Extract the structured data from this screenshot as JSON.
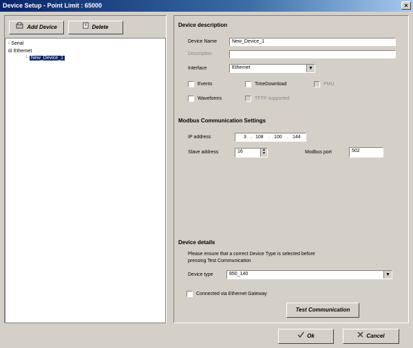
{
  "window": {
    "title": "Device Setup - Point Limit : 65000",
    "close_glyph": "×"
  },
  "left": {
    "add_device_label": "Add Device",
    "delete_label": "Delete",
    "tree": {
      "serial": "Serial",
      "ethernet": "Ethernet",
      "selected_device": "New_Device_1"
    }
  },
  "device_description": {
    "heading": "Device description",
    "name_label": "Device Name",
    "name_value": "New_Device_1",
    "description_label": "Description",
    "description_value": "",
    "interface_label": "Interface",
    "interface_value": "Ethernet",
    "events_label": "Events",
    "timedownload_label": "TimeDownload",
    "pmu_label": "PMU",
    "waveforms_label": "Waveforms",
    "tftp_label": "TFTP supported"
  },
  "modbus": {
    "heading": "Modbus Communication Settings",
    "ip_label": "IP address",
    "ip": [
      "3",
      "108",
      "100",
      "144"
    ],
    "slave_label": "Slave address",
    "slave_value": "16",
    "port_label": "Modbus port",
    "port_value": "502"
  },
  "device_details": {
    "heading": "Device details",
    "note_line1": "Please ensure that a correct Device Type is selected before",
    "note_line2": "pressing Test Communication",
    "type_label": "Device type",
    "type_value": "850_140",
    "gateway_label": "Connected via Ethernet Gateway",
    "test_label": "Test Communication"
  },
  "footer": {
    "ok_label": "Ok",
    "cancel_label": "Cancel"
  }
}
